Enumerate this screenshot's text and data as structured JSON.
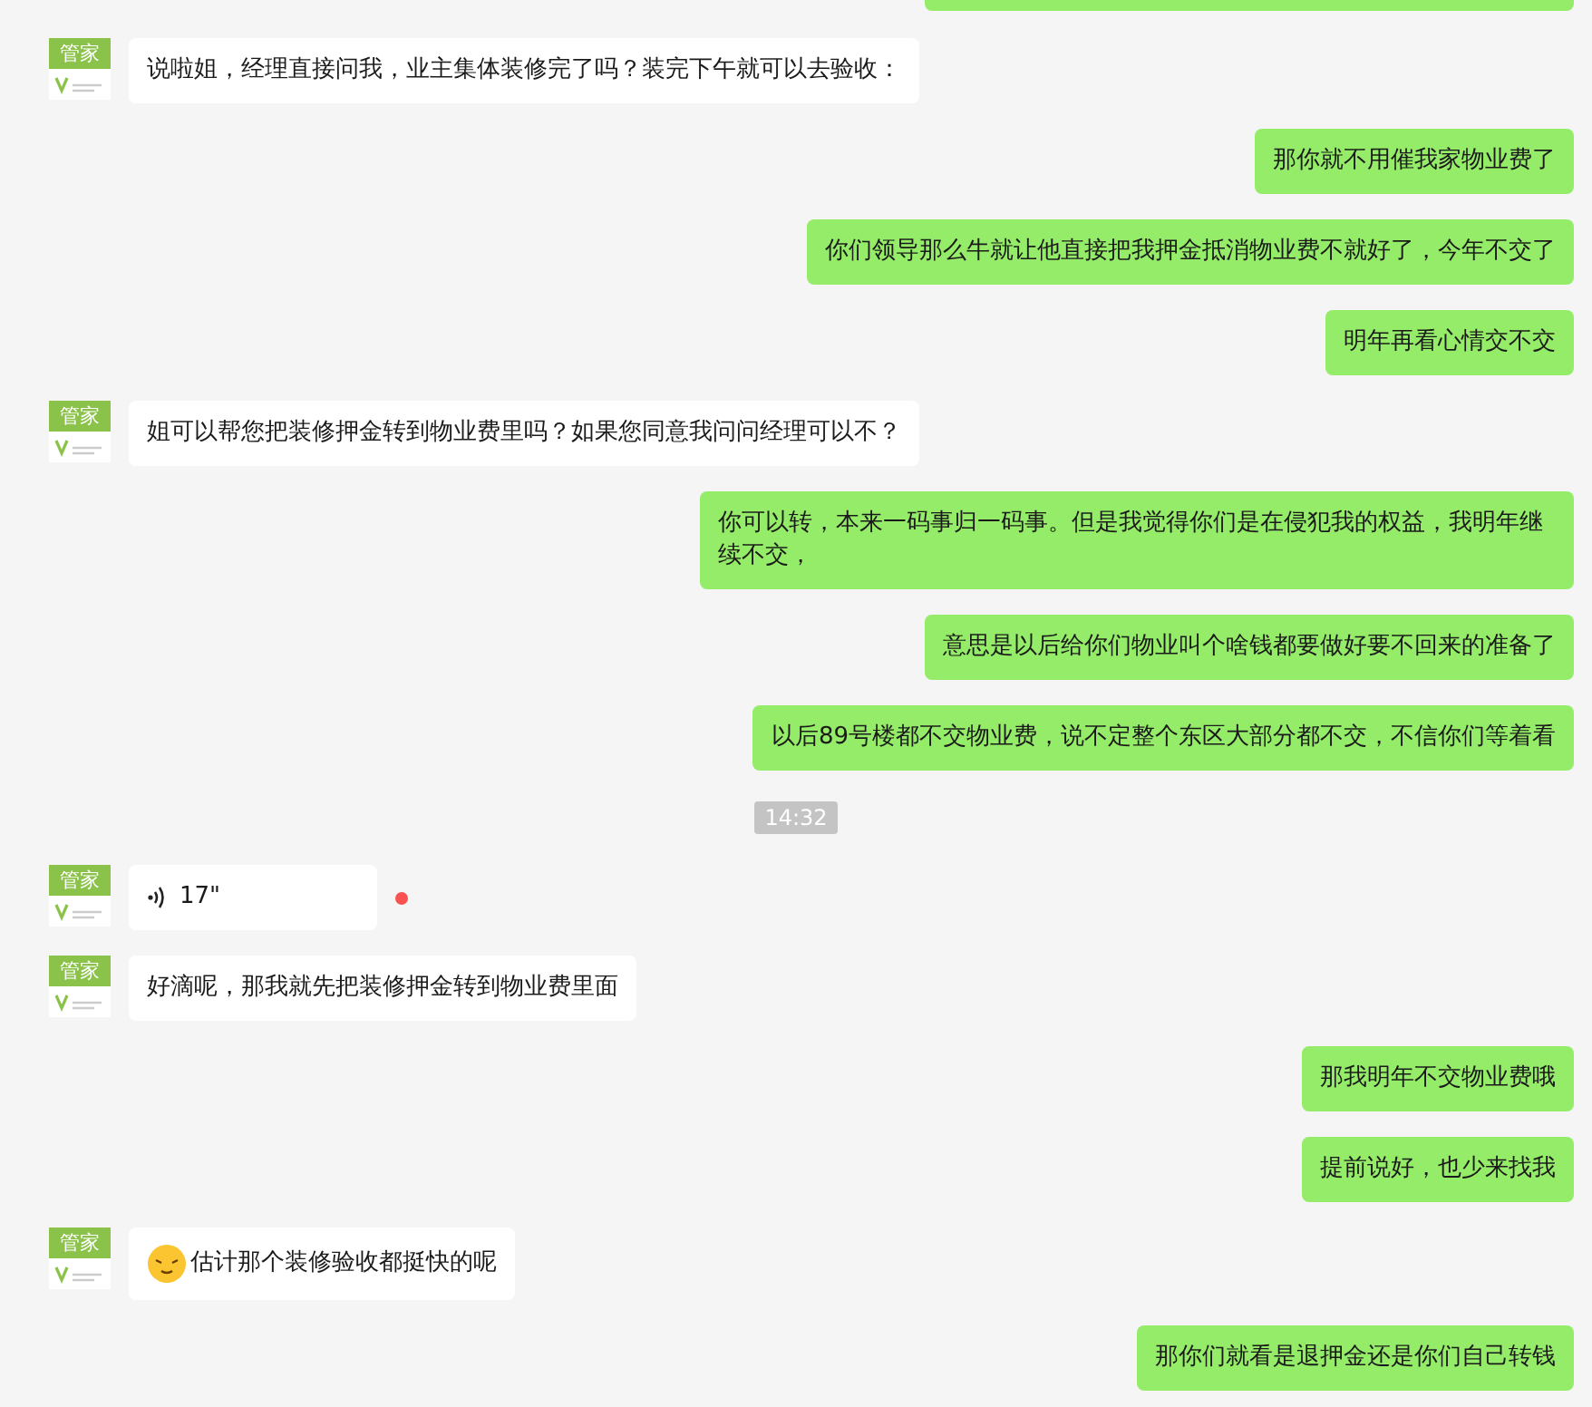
{
  "messages": [
    {
      "kind": "partial",
      "outgoing": true
    },
    {
      "kind": "text",
      "outgoing": false,
      "avatar": "管家",
      "text": "说啦姐，经理直接问我，业主集体装修完了吗？装完下午就可以去验收："
    },
    {
      "kind": "text",
      "outgoing": true,
      "text": "那你就不用催我家物业费了"
    },
    {
      "kind": "text",
      "outgoing": true,
      "text": "你们领导那么牛就让他直接把我押金抵消物业费不就好了，今年不交了"
    },
    {
      "kind": "text",
      "outgoing": true,
      "text": "明年再看心情交不交"
    },
    {
      "kind": "text",
      "outgoing": false,
      "avatar": "管家",
      "text": "姐可以帮您把装修押金转到物业费里吗？如果您同意我问问经理可以不？"
    },
    {
      "kind": "text",
      "outgoing": true,
      "text": "你可以转，本来一码事归一码事。但是我觉得你们是在侵犯我的权益，我明年继续不交，"
    },
    {
      "kind": "text",
      "outgoing": true,
      "text": "意思是以后给你们物业叫个啥钱都要做好要不回来的准备了"
    },
    {
      "kind": "text",
      "outgoing": true,
      "text": "以后89号楼都不交物业费，说不定整个东区大部分都不交，不信你们等着看"
    },
    {
      "kind": "time",
      "text": "14:32"
    },
    {
      "kind": "voice",
      "outgoing": false,
      "avatar": "管家",
      "text": "17\"",
      "unread": true
    },
    {
      "kind": "text",
      "outgoing": false,
      "avatar": "管家",
      "text": "好滴呢，那我就先把装修押金转到物业费里面"
    },
    {
      "kind": "text",
      "outgoing": true,
      "text": "那我明年不交物业费哦"
    },
    {
      "kind": "text",
      "outgoing": true,
      "text": "提前说好，也少来找我"
    },
    {
      "kind": "emoji",
      "outgoing": false,
      "avatar": "管家",
      "text": "估计那个装修验收都挺快的呢"
    },
    {
      "kind": "text",
      "outgoing": true,
      "text": "那你们就看是退押金还是你们自己转钱"
    }
  ]
}
